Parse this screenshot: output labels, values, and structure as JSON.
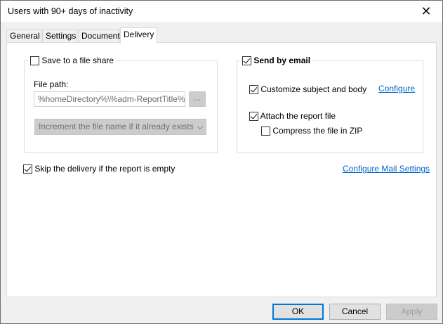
{
  "window": {
    "title": "Users with 90+ days of inactivity",
    "close_glyph": "✕"
  },
  "tabs": [
    {
      "label": "General",
      "active": false
    },
    {
      "label": "Settings",
      "active": false
    },
    {
      "label": "Document",
      "active": false
    },
    {
      "label": "Delivery",
      "active": true
    }
  ],
  "file_share": {
    "checkbox_label": "Save to a file share",
    "checked": false,
    "file_path_label": "File path:",
    "file_path_value": "%homeDirectory%\\%adm-ReportTitle%.ht",
    "browse_label": "...",
    "naming_option": "Increment the file name if it already exists"
  },
  "email": {
    "checkbox_label": "Send by email",
    "checked": true,
    "customize_label": "Customize subject and body",
    "customize_checked": true,
    "configure_link": "Configure",
    "attach_label": "Attach the report file",
    "attach_checked": true,
    "compress_label": "Compress the file in ZIP",
    "compress_checked": false
  },
  "skip_empty": {
    "label": "Skip the delivery if the report is empty",
    "checked": true
  },
  "configure_mail_link": "Configure Mail Settings",
  "buttons": {
    "ok": "OK",
    "cancel": "Cancel",
    "apply": "Apply"
  }
}
